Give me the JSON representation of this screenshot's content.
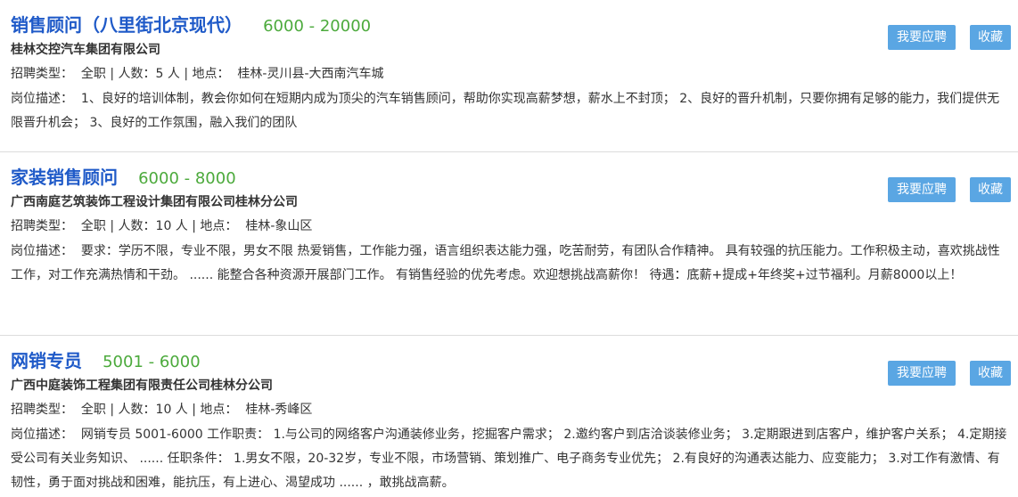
{
  "labels": {
    "type_prefix": "招聘类型：",
    "count_prefix": "人数：",
    "location_prefix": "地点：",
    "desc_prefix": "岗位描述：",
    "separator": "|"
  },
  "jobs": [
    {
      "title": "销售顾问（八里街北京现代）",
      "salary": "6000 - 20000",
      "company": "桂林交控汽车集团有限公司",
      "type": "全职",
      "count": "5 人",
      "location": "桂林-灵川县-大西南汽车城",
      "description": "1、良好的培训体制，教会你如何在短期内成为顶尖的汽车销售顾问，帮助你实现高薪梦想，薪水上不封顶； 2、良好的晋升机制，只要你拥有足够的能力，我们提供无限晋升机会； 3、良好的工作氛围，融入我们的团队",
      "apply_label": "我要应聘",
      "fav_label": "收藏"
    },
    {
      "title": "家装销售顾问",
      "salary": "6000 - 8000",
      "company": "广西南庭艺筑装饰工程设计集团有限公司桂林分公司",
      "type": "全职",
      "count": "10 人",
      "location": "桂林-象山区",
      "description": "要求：学历不限，专业不限，男女不限 热爱销售，工作能力强，语言组织表达能力强，吃苦耐劳，有团队合作精神。 具有较强的抗压能力。工作积极主动，喜欢挑战性工作，对工作充满热情和干劲。 ...... 能整合各种资源开展部门工作。 有销售经验的优先考虑。欢迎想挑战高薪你！ 待遇：底薪+提成+年终奖+过节福利。月薪8000以上！",
      "apply_label": "我要应聘",
      "fav_label": "收藏"
    },
    {
      "title": "网销专员",
      "salary": "5001 - 6000",
      "company": "广西中庭装饰工程集团有限责任公司桂林分公司",
      "type": "全职",
      "count": "10 人",
      "location": "桂林-秀峰区",
      "description": "网销专员 5001-6000 工作职责： 1.与公司的网络客户沟通装修业务，挖掘客户需求； 2.邀约客户到店洽谈装修业务； 3.定期跟进到店客户，维护客户关系； 4.定期接受公司有关业务知识、 ...... 任职条件： 1.男女不限，20-32岁，专业不限，市场营销、策划推广、电子商务专业优先； 2.有良好的沟通表达能力、应变能力； 3.对工作有激情、有韧性，勇于面对挑战和困难，能抗压，有上进心、渴望成功 ...... ，敢挑战高薪。",
      "apply_label": "我要应聘",
      "fav_label": "收藏"
    }
  ]
}
